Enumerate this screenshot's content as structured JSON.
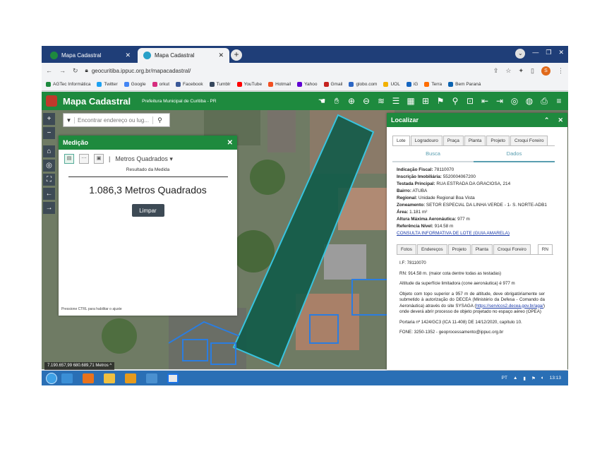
{
  "browser": {
    "tabs": [
      {
        "label": "Mapa Cadastral",
        "active": false
      },
      {
        "label": "Mapa Cadastral",
        "active": true
      }
    ],
    "new_tab": "+",
    "url": "geocuritiba.ippuc.org.br/mapacadastral/",
    "profile_letter": "S",
    "bookmarks": [
      {
        "label": "AGTec Informática",
        "color": "#1e8a3e"
      },
      {
        "label": "Twitter",
        "color": "#1da1f2"
      },
      {
        "label": "Google",
        "color": "#4285f4"
      },
      {
        "label": "orkut",
        "color": "#d62d7e"
      },
      {
        "label": "Facebook",
        "color": "#3b5998"
      },
      {
        "label": "Tumblr",
        "color": "#35465c"
      },
      {
        "label": "YouTube",
        "color": "#ff0000"
      },
      {
        "label": "Hotmail",
        "color": "#f25022"
      },
      {
        "label": "Yahoo",
        "color": "#6001d2"
      },
      {
        "label": "Gmail",
        "color": "#c5221f"
      },
      {
        "label": "globo.com",
        "color": "#2c66c4"
      },
      {
        "label": "UOL",
        "color": "#f2b100"
      },
      {
        "label": "iG",
        "color": "#1565c0"
      },
      {
        "label": "Terra",
        "color": "#ff6d00"
      },
      {
        "label": "Bem Paraná",
        "color": "#0b62b0"
      }
    ]
  },
  "app": {
    "title": "Mapa Cadastral",
    "subtitle": "Prefeitura Municipal de Curitiba - PR",
    "brand_color": "#1e8a3e",
    "search_placeholder": "Encontrar endereço ou lug..."
  },
  "medicao": {
    "title": "Medição",
    "unit": "Metros Quadrados",
    "result_label": "Resultado da Medida",
    "result_value": "1.086,3 Metros Quadrados",
    "clear_button": "Limpar",
    "hint": "Pressione CTRL para habilitar o ajuste"
  },
  "coordinates": "7.190.657,99 680.689,71 Metros",
  "localizar": {
    "title": "Localizar",
    "tabs": [
      "Lote",
      "Logradouro",
      "Praça",
      "Planta",
      "Projeto",
      "Croqui Foreiro"
    ],
    "subtabs": [
      "Busca",
      "Dados"
    ],
    "fields": [
      {
        "label": "Indicação Fiscal:",
        "value": "78110070"
      },
      {
        "label": "Inscrição Imobiliária:",
        "value": "5520004067200"
      },
      {
        "label": "Testada Principal:",
        "value": "RUA ESTRADA DA GRACIOSA, 214"
      },
      {
        "label": "Bairro:",
        "value": "ATUBA"
      },
      {
        "label": "Regional:",
        "value": "Unidade Regional Boa Vista"
      },
      {
        "label": "Zoneamento:",
        "value": "SETOR ESPECIAL DA LINHA VERDE - 1- S. NORTE-ADB1"
      },
      {
        "label": "Área:",
        "value": "1.181 m²"
      },
      {
        "label": "Altura Máxima Aeronáutica:",
        "value": "977 m"
      },
      {
        "label": "Referência Nível:",
        "value": "914.58 m"
      }
    ],
    "link": "CONSULTA INFORMATIVA DE LOTE (GUIA AMARELA)",
    "detail_tabs": [
      "Fotos",
      "Endereços",
      "Projeto",
      "Planta",
      "Croqui Foreiro",
      "RN"
    ],
    "rn": {
      "if_line": "I.F: 78110070",
      "rn_line": "RN: 914.58 m. (maior cota dentre todas as testadas)",
      "altitude": "Altitude da superfície limitadora (cone aeronáutica) é 977 m",
      "obj_1": "Objeto com topo superior a 957 m de altitude, deve obrigatóriamente ser submetido à autorização do DECEA (Ministério da Defesa - Comando da Aeronáutica) através do site SYSAGA (",
      "obj_link": "https://servicos2.decea.gov.br/aga/",
      "obj_2": ") onde deverá abrir processo de objeto projetado no espaço aéreo (OPEA)",
      "portaria": "Portaria nº 1424/GC3 (ICA 11-408) DE 14/12/2020, capítulo 10.",
      "fone": "FONE: 3250-1352 - geoprocessamento@ippuc.org.br"
    }
  },
  "taskbar": {
    "lang": "PT",
    "time": "13:13"
  }
}
